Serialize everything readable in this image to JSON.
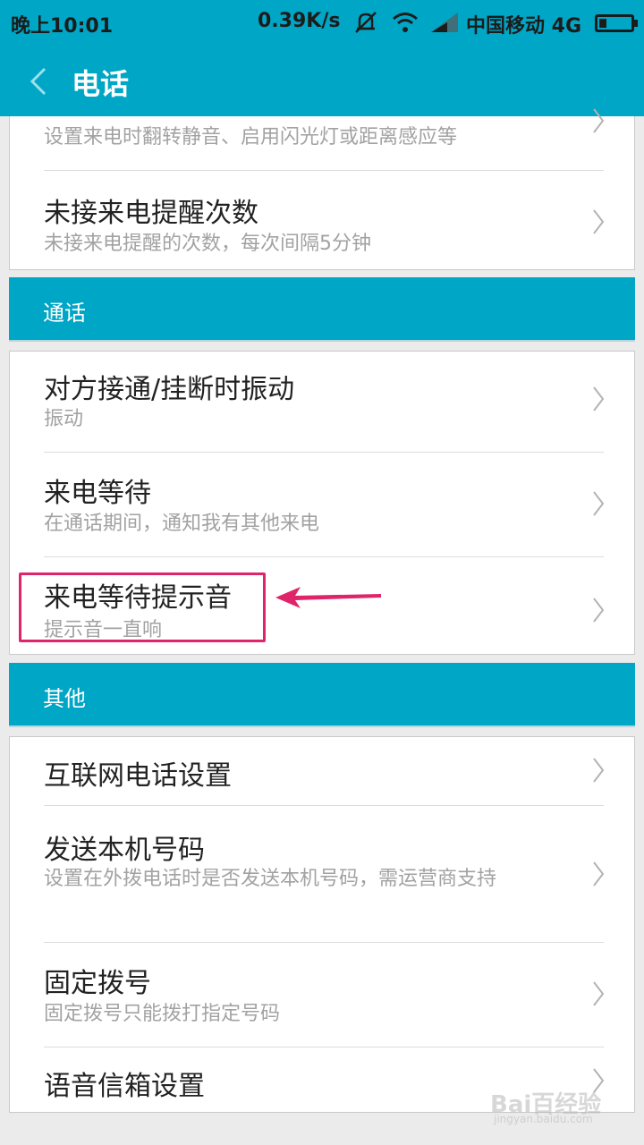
{
  "status_bar": {
    "time": "晚上10:01",
    "speed": "0.39K/s",
    "carrier": "中国移动 4G",
    "icons": [
      "mute-icon",
      "wifi-icon",
      "signal-icon",
      "battery-icon"
    ]
  },
  "app_bar": {
    "title": "电话",
    "back_icon": "chevron-left-icon"
  },
  "cards": [
    {
      "items": [
        {
          "title": "",
          "subtitle": "设置来电时翻转静音、启用闪光灯或距离感应等"
        },
        {
          "title": "未接来电提醒次数",
          "subtitle": "未接来电提醒的次数，每次间隔5分钟"
        }
      ]
    },
    {
      "items": [
        {
          "title": "对方接通/挂断时振动",
          "subtitle": "振动"
        },
        {
          "title": "来电等待",
          "subtitle": "在通话期间，通知我有其他来电"
        },
        {
          "title": "来电等待提示音",
          "subtitle": "提示音一直响"
        }
      ]
    },
    {
      "items": [
        {
          "title": "互联网电话设置",
          "subtitle": ""
        },
        {
          "title": "发送本机号码",
          "subtitle": "设置在外拨电话时是否发送本机号码，需运营商支持"
        },
        {
          "title": "固定拨号",
          "subtitle": "固定拨号只能拨打指定号码"
        },
        {
          "title": "语音信箱设置",
          "subtitle": ""
        }
      ]
    }
  ],
  "sections": [
    "通话",
    "其他"
  ],
  "colors": {
    "accent": "#00a6c5",
    "annotation": "#e0246a"
  },
  "watermark": {
    "brand": "Bai百经验",
    "url": "jingyan.baidu.com"
  }
}
